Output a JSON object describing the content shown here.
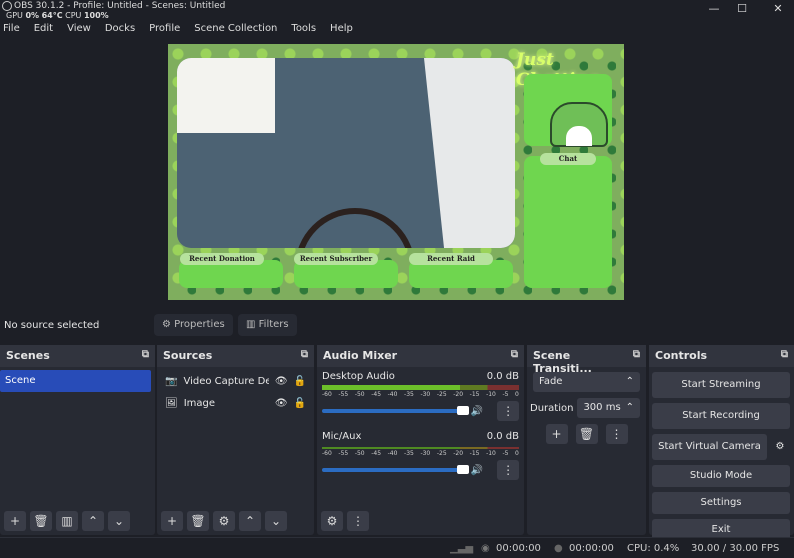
{
  "window": {
    "title": "OBS 30.1.2 - Profile: Untitled - Scenes: Untitled",
    "min": "—",
    "max": "☐",
    "close": "✕"
  },
  "stats": {
    "gpu_label": "GPU",
    "gpu": "0%",
    "temp": "64°C",
    "cpu_label": "CPU",
    "cpu": "100%"
  },
  "menu": [
    "File",
    "Edit",
    "View",
    "Docks",
    "Profile",
    "Scene Collection",
    "Tools",
    "Help"
  ],
  "preview": {
    "title": "Just Chatting",
    "chat": "Chat",
    "donation": "Recent Donation",
    "subscriber": "Recent Subscriber",
    "raid": "Recent Raid"
  },
  "source_toolbar": {
    "status": "No source selected",
    "properties": "Properties",
    "filters": "Filters"
  },
  "scenes": {
    "title": "Scenes",
    "items": [
      "Scene"
    ]
  },
  "sources": {
    "title": "Sources",
    "items": [
      "Video Capture Device",
      "Image"
    ]
  },
  "mixer": {
    "title": "Audio Mixer",
    "ticks": [
      "-60",
      "-55",
      "-50",
      "-45",
      "-40",
      "-35",
      "-30",
      "-25",
      "-20",
      "-15",
      "-10",
      "-5",
      "0"
    ],
    "channels": [
      {
        "name": "Desktop Audio",
        "level": "0.0 dB",
        "volume": 1.0
      },
      {
        "name": "Mic/Aux",
        "level": "0.0 dB",
        "volume": 1.0
      }
    ]
  },
  "transitions": {
    "title": "Scene Transiti...",
    "selected": "Fade",
    "duration_label": "Duration",
    "duration": "300 ms"
  },
  "controls": {
    "title": "Controls",
    "start_streaming": "Start Streaming",
    "start_recording": "Start Recording",
    "virtual_camera": "Start Virtual Camera",
    "studio_mode": "Studio Mode",
    "settings": "Settings",
    "exit": "Exit"
  },
  "status": {
    "stream_time": "00:00:00",
    "record_time": "00:00:00",
    "cpu": "CPU: 0.4%",
    "fps": "30.00 / 30.00 FPS"
  }
}
